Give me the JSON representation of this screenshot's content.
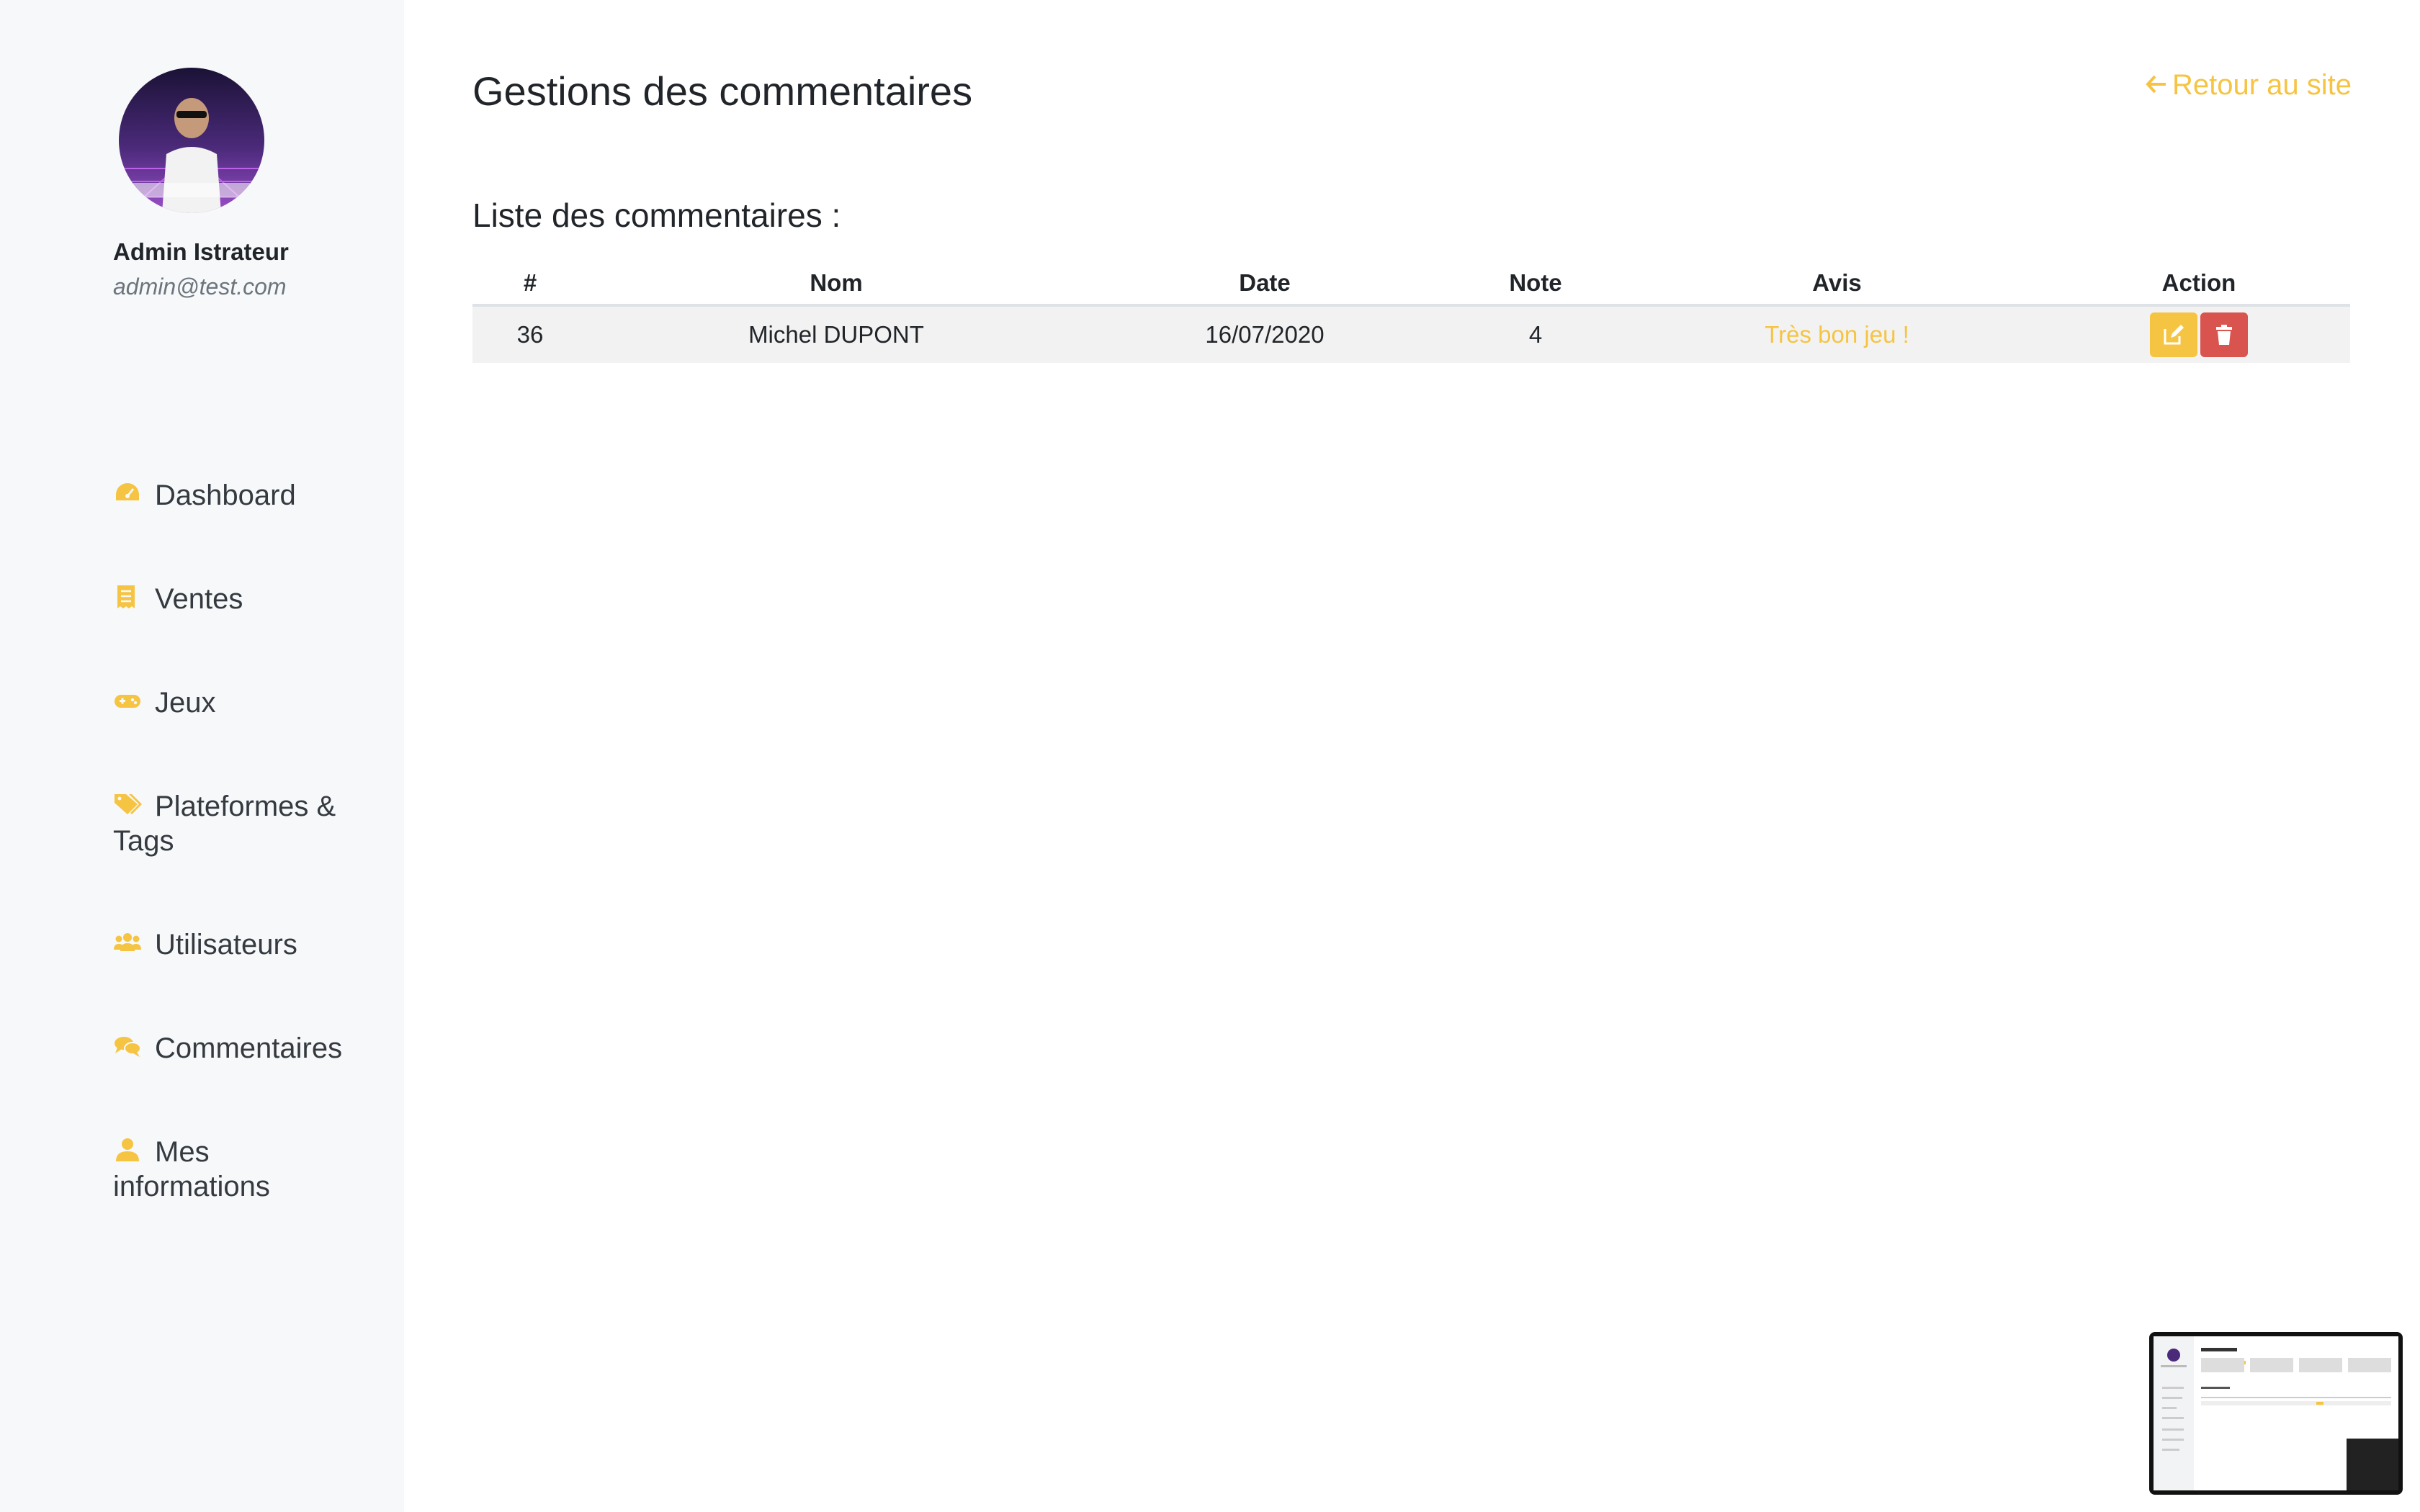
{
  "profile": {
    "name": "Admin Istrateur",
    "email": "admin@test.com"
  },
  "nav": {
    "items": [
      {
        "label": "Dashboard",
        "icon": "tachometer-icon"
      },
      {
        "label": "Ventes",
        "icon": "receipt-icon"
      },
      {
        "label": "Jeux",
        "icon": "gamepad-icon"
      },
      {
        "label": "Plateformes & Tags",
        "icon": "tags-icon"
      },
      {
        "label": "Utilisateurs",
        "icon": "users-icon"
      },
      {
        "label": "Commentaires",
        "icon": "comments-icon"
      },
      {
        "label": "Mes informations",
        "icon": "user-icon"
      }
    ]
  },
  "header": {
    "title": "Gestions des commentaires",
    "back_label": "Retour au site"
  },
  "main": {
    "section_title": "Liste des commentaires :",
    "table": {
      "headers": [
        "#",
        "Nom",
        "Date",
        "Note",
        "Avis",
        "Action"
      ],
      "rows": [
        {
          "id": "36",
          "nom": "Michel DUPONT",
          "date": "16/07/2020",
          "note": "4",
          "avis": "Très bon jeu !"
        }
      ]
    }
  },
  "colors": {
    "accent": "#f6c443",
    "danger": "#d9534f",
    "sidebar_bg": "#f7f8f9"
  }
}
